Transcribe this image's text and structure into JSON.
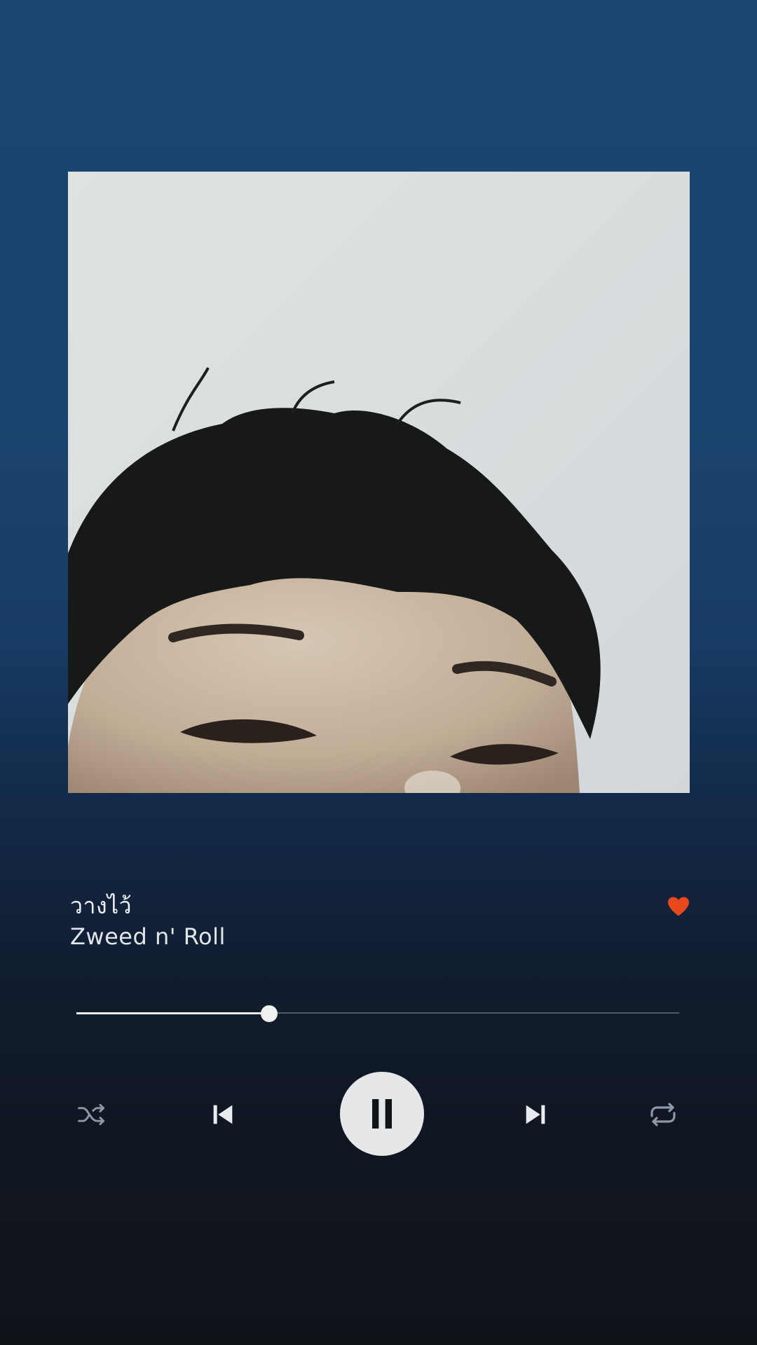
{
  "track": {
    "title": "วางไว้",
    "artist": "Zweed n' Roll",
    "liked": true
  },
  "playback": {
    "progress": 0.32,
    "state": "playing"
  },
  "controls": {
    "shuffle_icon": "shuffle-icon",
    "previous_icon": "skip-previous-icon",
    "play_pause_icon": "pause-icon",
    "next_icon": "skip-next-icon",
    "repeat_icon": "repeat-icon"
  },
  "colors": {
    "background_top": "#1b4572",
    "background_bottom": "#0f1318",
    "heart": "#e8481c",
    "play_button": "#e6e7e8",
    "icon": "#e9ecef"
  }
}
